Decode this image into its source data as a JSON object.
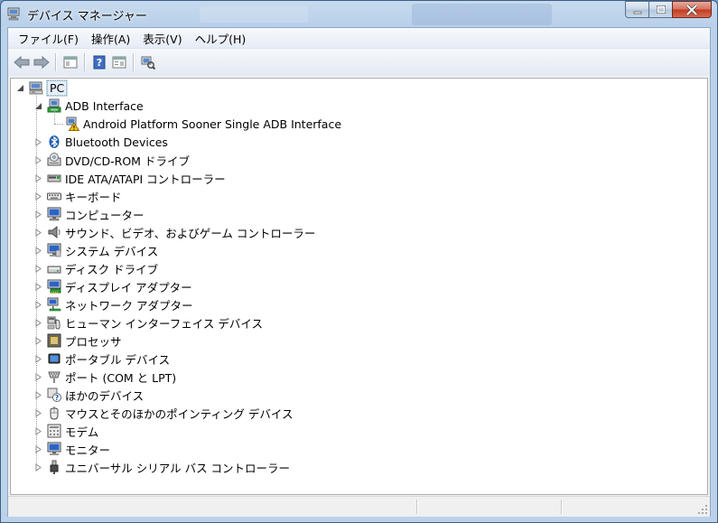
{
  "window": {
    "title": "デバイス マネージャー"
  },
  "menu": [
    {
      "label": "ファイル(F)",
      "name": "menu-file"
    },
    {
      "label": "操作(A)",
      "name": "menu-action"
    },
    {
      "label": "表示(V)",
      "name": "menu-view"
    },
    {
      "label": "ヘルプ(H)",
      "name": "menu-help"
    }
  ],
  "toolbar": {
    "buttons": [
      "back-arrow-icon",
      "forward-arrow-icon",
      "show-hide-tree-icon",
      "help-icon",
      "properties-icon",
      "scan-hardware-icon"
    ]
  },
  "tree": {
    "root": {
      "label": "PC",
      "icon": "computer-icon",
      "expanded": true
    },
    "categories": [
      {
        "label": "ADB Interface",
        "icon": "adb-device-icon",
        "expanded": true,
        "children": [
          {
            "label": "Android Platform Sooner Single ADB Interface",
            "icon": "warning-device-icon"
          }
        ]
      },
      {
        "label": "Bluetooth Devices",
        "icon": "bluetooth-icon"
      },
      {
        "label": "DVD/CD-ROM ドライブ",
        "icon": "dvd-drive-icon"
      },
      {
        "label": "IDE ATA/ATAPI コントローラー",
        "icon": "ide-controller-icon"
      },
      {
        "label": "キーボード",
        "icon": "keyboard-icon"
      },
      {
        "label": "コンピューター",
        "icon": "computer-monitor-icon"
      },
      {
        "label": "サウンド、ビデオ、およびゲーム コントローラー",
        "icon": "speaker-icon"
      },
      {
        "label": "システム デバイス",
        "icon": "system-device-icon"
      },
      {
        "label": "ディスク ドライブ",
        "icon": "disk-drive-icon"
      },
      {
        "label": "ディスプレイ アダプター",
        "icon": "display-adapter-icon"
      },
      {
        "label": "ネットワーク アダプター",
        "icon": "network-adapter-icon"
      },
      {
        "label": "ヒューマン インターフェイス デバイス",
        "icon": "hid-icon"
      },
      {
        "label": "プロセッサ",
        "icon": "processor-icon"
      },
      {
        "label": "ポータブル デバイス",
        "icon": "portable-device-icon"
      },
      {
        "label": "ポート (COM と LPT)",
        "icon": "port-icon"
      },
      {
        "label": "ほかのデバイス",
        "icon": "unknown-device-icon"
      },
      {
        "label": "マウスとそのほかのポインティング デバイス",
        "icon": "mouse-icon"
      },
      {
        "label": "モデム",
        "icon": "modem-icon"
      },
      {
        "label": "モニター",
        "icon": "monitor-icon"
      },
      {
        "label": "ユニバーサル シリアル バス コントローラー",
        "icon": "usb-icon"
      }
    ]
  },
  "colors": {
    "selection_bg": "#e5eef9",
    "titlebar": "#b9d0ea",
    "close_button": "#c33a1f"
  }
}
